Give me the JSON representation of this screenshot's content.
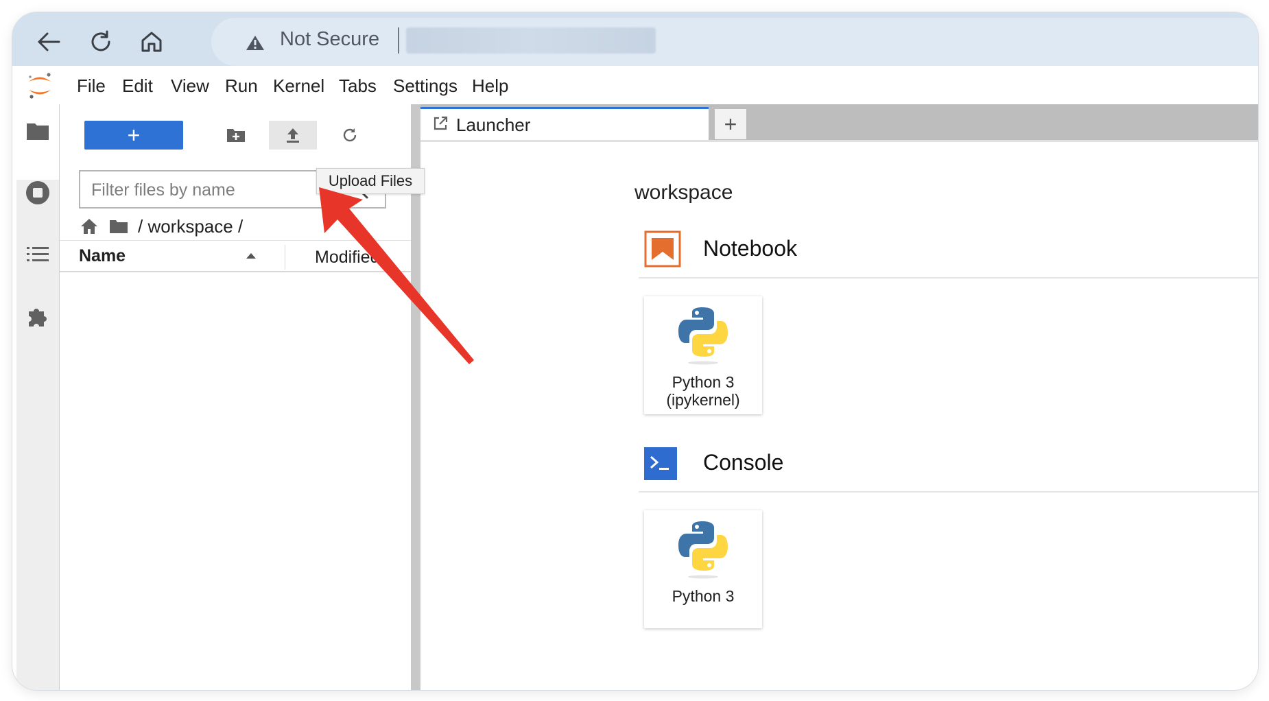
{
  "browser": {
    "security_label": "Not Secure",
    "icons": {
      "back": "back-arrow-icon",
      "reload": "reload-icon",
      "home": "home-icon",
      "warning": "warning-triangle-icon"
    }
  },
  "menubar": {
    "items": [
      "File",
      "Edit",
      "View",
      "Run",
      "Kernel",
      "Tabs",
      "Settings",
      "Help"
    ]
  },
  "filebrowser": {
    "new_label": "+",
    "filter_placeholder": "Filter files by name",
    "path": "/ workspace /",
    "columns": {
      "name": "Name",
      "modified": "Modified"
    },
    "tooltip": "Upload Files"
  },
  "tabs": [
    {
      "label": "Launcher"
    }
  ],
  "tab_add_label": "+",
  "launcher": {
    "cwd": "workspace",
    "sections": [
      {
        "title": "Notebook",
        "cards": [
          {
            "line1": "Python 3",
            "line2": "(ipykernel)"
          }
        ]
      },
      {
        "title": "Console",
        "cards": [
          {
            "line1": "Python 3",
            "line2": ""
          }
        ]
      }
    ]
  },
  "colors": {
    "accent_blue": "#2f72d6",
    "notebook_orange": "#e46e2e",
    "console_blue": "#2f6ccf",
    "annotation_red": "#e8352a",
    "python_blue": "#3e74a8",
    "python_yellow": "#fed642"
  }
}
